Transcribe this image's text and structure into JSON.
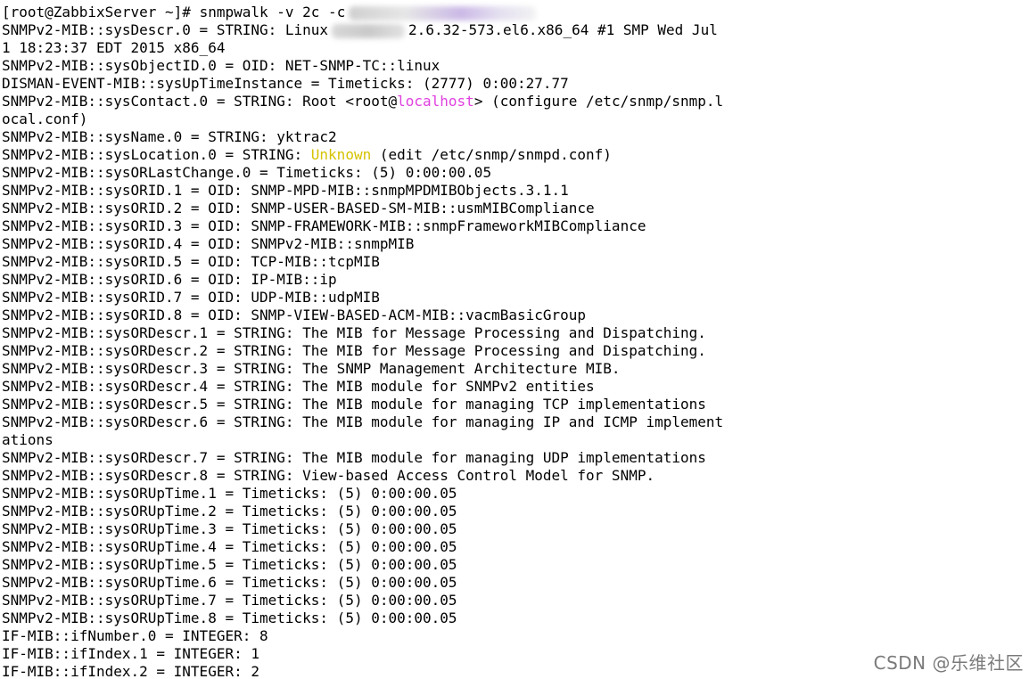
{
  "terminal": {
    "prompt": "[root@ZabbixServer ~]# ",
    "command": "snmpwalk -v 2c -c",
    "descr_prefix": "SNMPv2-MIB::sysDescr.0 = STRING: Linux",
    "descr_suffix": "2.6.32-573.el6.x86_64 #1 SMP Wed Jul",
    "descr_wrap": "1 18:23:37 EDT 2015 x86_64",
    "line_objectid": "SNMPv2-MIB::sysObjectID.0 = OID: NET-SNMP-TC::linux",
    "line_uptime": "DISMAN-EVENT-MIB::sysUpTimeInstance = Timeticks: (2777) 0:00:27.77",
    "contact_prefix": "SNMPv2-MIB::sysContact.0 = STRING: Root <root@",
    "contact_host": "localhost",
    "contact_suffix": "> (configure /etc/snmp/snmp.l",
    "contact_wrap": "ocal.conf)",
    "line_sysname": "SNMPv2-MIB::sysName.0 = STRING: yktrac2",
    "location_prefix": "SNMPv2-MIB::sysLocation.0 = STRING: ",
    "location_value": "Unknown",
    "location_suffix": " (edit /etc/snmp/snmpd.conf)",
    "lines_block1": [
      "SNMPv2-MIB::sysORLastChange.0 = Timeticks: (5) 0:00:00.05",
      "SNMPv2-MIB::sysORID.1 = OID: SNMP-MPD-MIB::snmpMPDMIBObjects.3.1.1",
      "SNMPv2-MIB::sysORID.2 = OID: SNMP-USER-BASED-SM-MIB::usmMIBCompliance",
      "SNMPv2-MIB::sysORID.3 = OID: SNMP-FRAMEWORK-MIB::snmpFrameworkMIBCompliance",
      "SNMPv2-MIB::sysORID.4 = OID: SNMPv2-MIB::snmpMIB",
      "SNMPv2-MIB::sysORID.5 = OID: TCP-MIB::tcpMIB",
      "SNMPv2-MIB::sysORID.6 = OID: IP-MIB::ip",
      "SNMPv2-MIB::sysORID.7 = OID: UDP-MIB::udpMIB",
      "SNMPv2-MIB::sysORID.8 = OID: SNMP-VIEW-BASED-ACM-MIB::vacmBasicGroup",
      "SNMPv2-MIB::sysORDescr.1 = STRING: The MIB for Message Processing and Dispatching.",
      "SNMPv2-MIB::sysORDescr.2 = STRING: The MIB for Message Processing and Dispatching.",
      "SNMPv2-MIB::sysORDescr.3 = STRING: The SNMP Management Architecture MIB.",
      "SNMPv2-MIB::sysORDescr.4 = STRING: The MIB module for SNMPv2 entities",
      "SNMPv2-MIB::sysORDescr.5 = STRING: The MIB module for managing TCP implementations",
      "SNMPv2-MIB::sysORDescr.6 = STRING: The MIB module for managing IP and ICMP implement",
      "ations",
      "SNMPv2-MIB::sysORDescr.7 = STRING: The MIB module for managing UDP implementations",
      "SNMPv2-MIB::sysORDescr.8 = STRING: View-based Access Control Model for SNMP.",
      "SNMPv2-MIB::sysORUpTime.1 = Timeticks: (5) 0:00:00.05",
      "SNMPv2-MIB::sysORUpTime.2 = Timeticks: (5) 0:00:00.05",
      "SNMPv2-MIB::sysORUpTime.3 = Timeticks: (5) 0:00:00.05",
      "SNMPv2-MIB::sysORUpTime.4 = Timeticks: (5) 0:00:00.05",
      "SNMPv2-MIB::sysORUpTime.5 = Timeticks: (5) 0:00:00.05",
      "SNMPv2-MIB::sysORUpTime.6 = Timeticks: (5) 0:00:00.05",
      "SNMPv2-MIB::sysORUpTime.7 = Timeticks: (5) 0:00:00.05",
      "SNMPv2-MIB::sysORUpTime.8 = Timeticks: (5) 0:00:00.05",
      "IF-MIB::ifNumber.0 = INTEGER: 8",
      "IF-MIB::ifIndex.1 = INTEGER: 1",
      "IF-MIB::ifIndex.2 = INTEGER: 2"
    ],
    "colors": {
      "background": "#ffffff",
      "text": "#000000",
      "localhost": "#e040e0",
      "unknown": "#d6c200"
    }
  },
  "watermark": "CSDN @乐维社区"
}
